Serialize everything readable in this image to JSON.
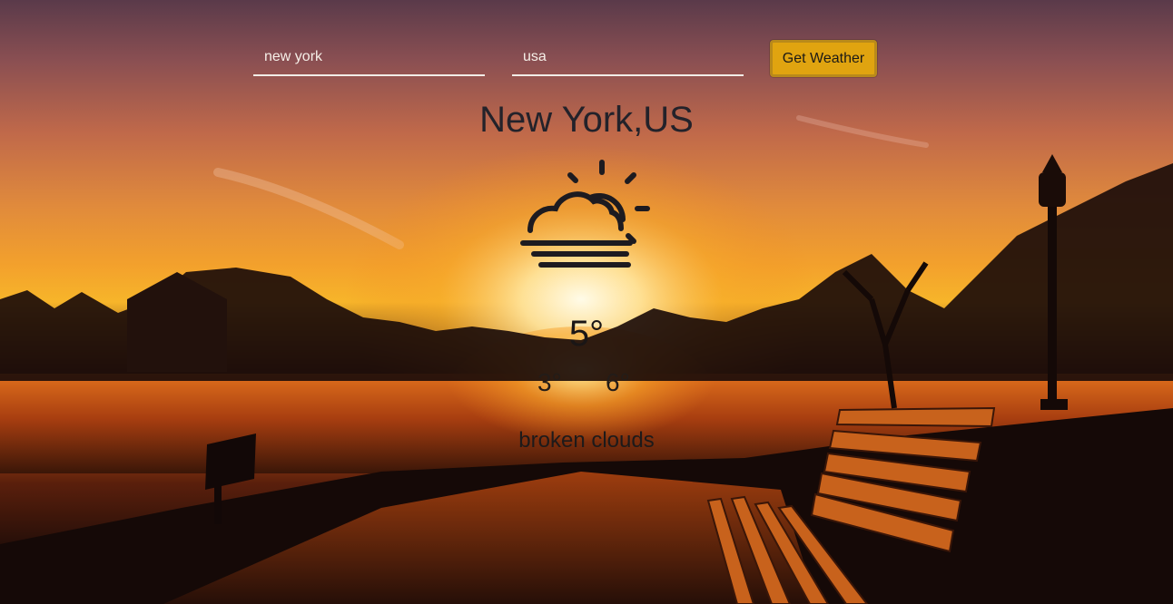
{
  "search": {
    "city_value": "new york",
    "country_value": "usa",
    "button_label": "Get Weather"
  },
  "weather": {
    "location": "New York,US",
    "condition_icon": "sun-fog-icon",
    "temperature": "5°",
    "temp_min": "3°",
    "temp_max": "6°",
    "description": "broken clouds"
  },
  "colors": {
    "button": "#e0a410",
    "text": "#23222a",
    "input_underline": "#f2ece6"
  }
}
